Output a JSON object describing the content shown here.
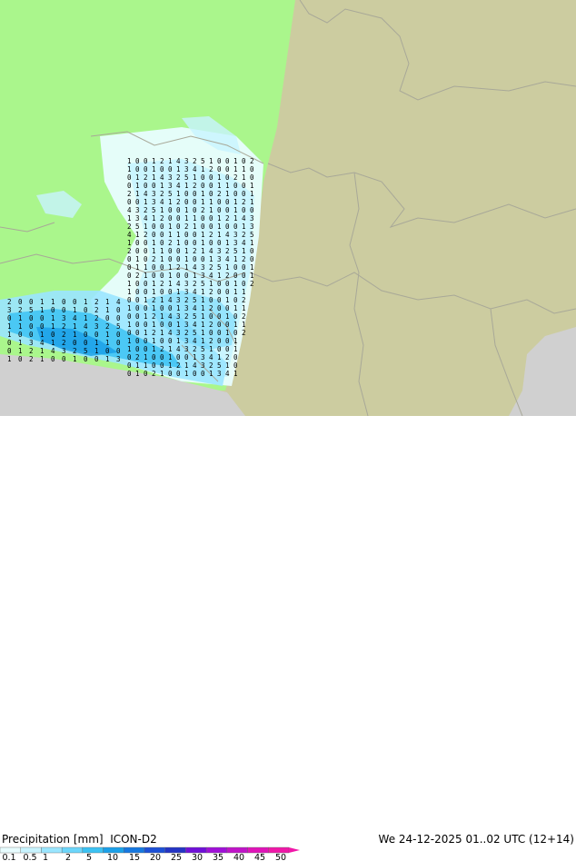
{
  "header": {
    "title": "Precipitation [mm]",
    "model": "ICON-D2",
    "valid_time": "We 24-12-2025 01..02 UTC (12+14)"
  },
  "legend": {
    "labels": [
      "0.1",
      "0.5",
      "1",
      "2",
      "5",
      "10",
      "15",
      "20",
      "25",
      "30",
      "35",
      "40",
      "45",
      "50"
    ],
    "colors": [
      "#e8fdff",
      "#c8f4ff",
      "#9ae6ff",
      "#6cd6fb",
      "#3cc2f3",
      "#1ba0e8",
      "#1678e0",
      "#1c50d6",
      "#2434c4",
      "#7010d8",
      "#a010d8",
      "#c014c8",
      "#e014b8",
      "#f018a8"
    ]
  },
  "map": {
    "land_color": "#cccca0",
    "model_domain_color": "#aaf68c",
    "sea_color": "#d0d0d0",
    "border_color": "#a8a898",
    "value_labels": [
      "1",
      "0",
      "0",
      "1",
      "2",
      "1",
      "4",
      "3",
      "2",
      "5",
      "1",
      "0",
      "0",
      "1",
      "0",
      "2",
      "1",
      "0",
      "0",
      "1",
      "0",
      "0",
      "1",
      "3",
      "4",
      "1",
      "2",
      "0",
      "0",
      "1"
    ]
  }
}
